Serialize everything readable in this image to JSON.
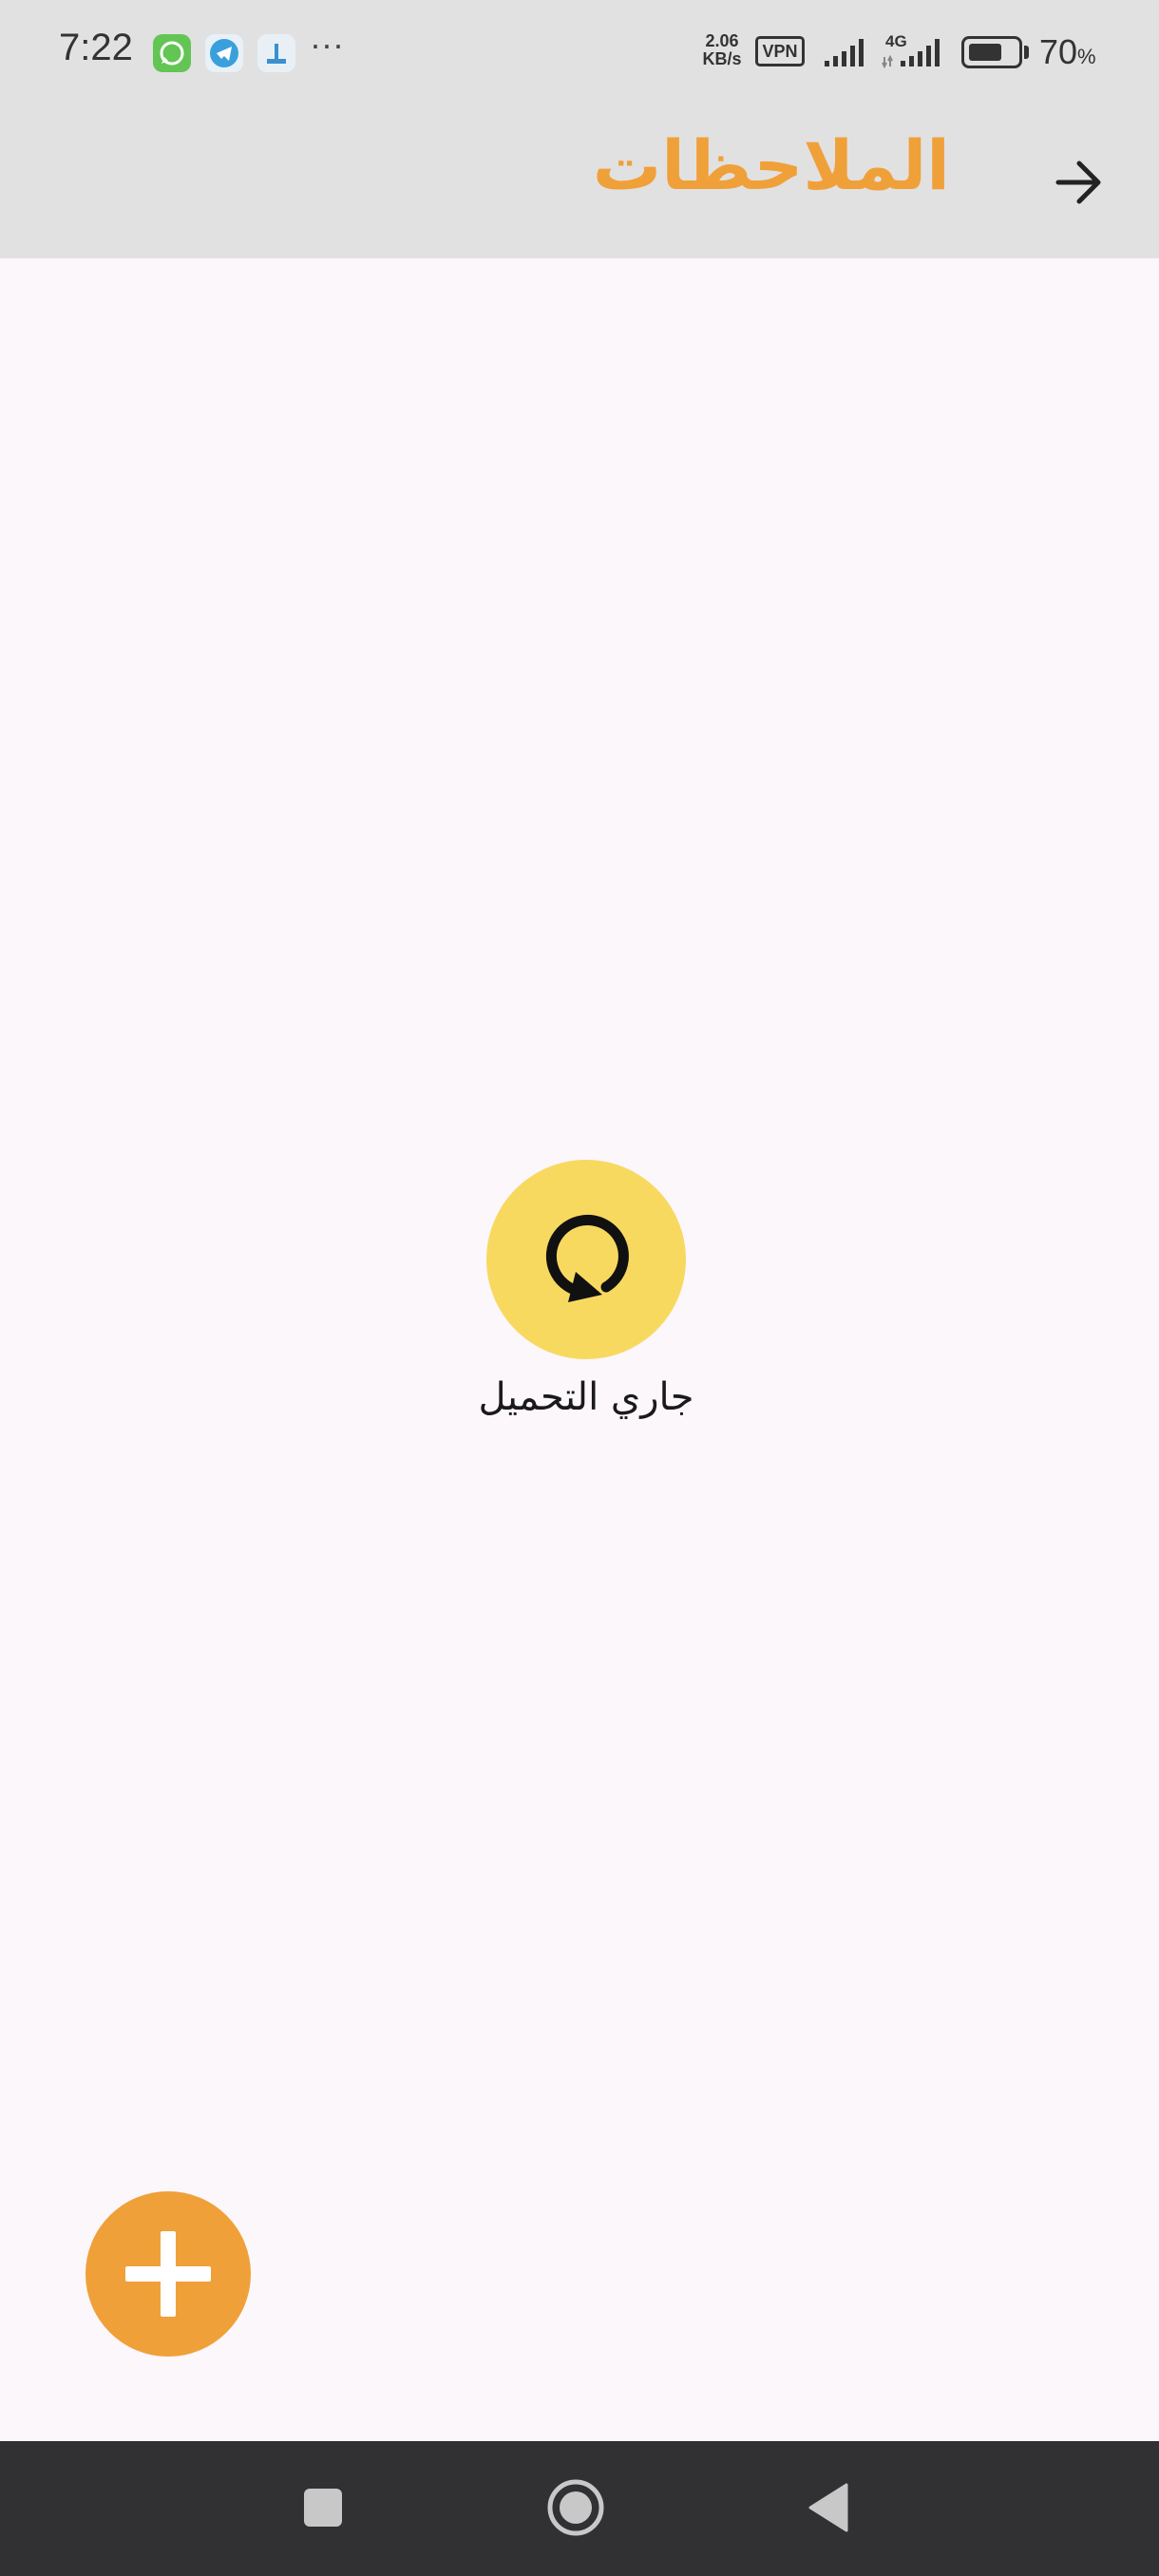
{
  "status_bar": {
    "time": "7:22",
    "more": "···",
    "net_speed_value": "2.06",
    "net_speed_unit": "KB/s",
    "vpn_label": "VPN",
    "network_type": "4G",
    "battery_level": "70",
    "battery_unit": "%",
    "battery_fraction": 0.7,
    "notification_icons": [
      "whatsapp-icon",
      "telegram-icon",
      "app-notification-icon"
    ]
  },
  "app_bar": {
    "title": "الملاحظات",
    "back_icon": "arrow-right-icon"
  },
  "loading": {
    "label": "جاري التحميل",
    "icon": "refresh-icon"
  },
  "fab": {
    "icon": "plus-icon"
  },
  "nav_bar": {
    "buttons": [
      "recents-icon",
      "home-icon",
      "back-triangle-icon"
    ]
  },
  "colors": {
    "accent": "#f0a039",
    "loading_circle": "#f8d960",
    "app_bar_bg": "#e1e1e1",
    "page_bg": "#fcf7fb",
    "nav_bar_bg": "#313033"
  }
}
